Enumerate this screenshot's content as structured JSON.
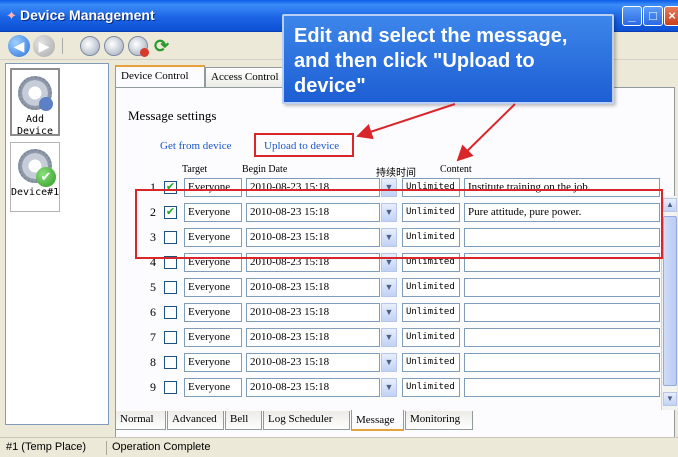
{
  "window": {
    "title": "Device Management"
  },
  "sidebar": {
    "add_label_line1": "Add",
    "add_label_line2": "Device",
    "device_label": "Device#1"
  },
  "tabs_top": [
    "Device Control",
    "Access Control"
  ],
  "message_settings": {
    "title": "Message settings",
    "get_link": "Get from device",
    "upload_link": "Upload to device",
    "headers": {
      "target": "Target",
      "begin_date": "Begin Date",
      "duration": "持续时间",
      "content": "Content"
    }
  },
  "rows": [
    {
      "num": "1",
      "checked": true,
      "target": "Everyone",
      "date": "2010-08-23 15:18",
      "duration": "Unlimited",
      "content": "Institute training on the job."
    },
    {
      "num": "2",
      "checked": true,
      "target": "Everyone",
      "date": "2010-08-23 15:18",
      "duration": "Unlimited",
      "content": "Pure attitude, pure power."
    },
    {
      "num": "3",
      "checked": false,
      "target": "Everyone",
      "date": "2010-08-23 15:18",
      "duration": "Unlimited",
      "content": ""
    },
    {
      "num": "4",
      "checked": false,
      "target": "Everyone",
      "date": "2010-08-23 15:18",
      "duration": "Unlimited",
      "content": ""
    },
    {
      "num": "5",
      "checked": false,
      "target": "Everyone",
      "date": "2010-08-23 15:18",
      "duration": "Unlimited",
      "content": ""
    },
    {
      "num": "6",
      "checked": false,
      "target": "Everyone",
      "date": "2010-08-23 15:18",
      "duration": "Unlimited",
      "content": ""
    },
    {
      "num": "7",
      "checked": false,
      "target": "Everyone",
      "date": "2010-08-23 15:18",
      "duration": "Unlimited",
      "content": ""
    },
    {
      "num": "8",
      "checked": false,
      "target": "Everyone",
      "date": "2010-08-23 15:18",
      "duration": "Unlimited",
      "content": ""
    },
    {
      "num": "9",
      "checked": false,
      "target": "Everyone",
      "date": "2010-08-23 15:18",
      "duration": "Unlimited",
      "content": ""
    }
  ],
  "tabs_bottom": [
    "Normal",
    "Advanced",
    "Bell",
    "Log Scheduler",
    "Message",
    "Monitoring"
  ],
  "callout": {
    "text": "Edit and select the message, and then click \"Upload to device\""
  },
  "status": {
    "place": "#1 (Temp Place)",
    "message": "Operation Complete"
  },
  "colors": {
    "title_bar": "#1c66e6",
    "annotation": "#d9262b",
    "link": "#1a56c8",
    "callout_bg": "#2a6fe0"
  }
}
